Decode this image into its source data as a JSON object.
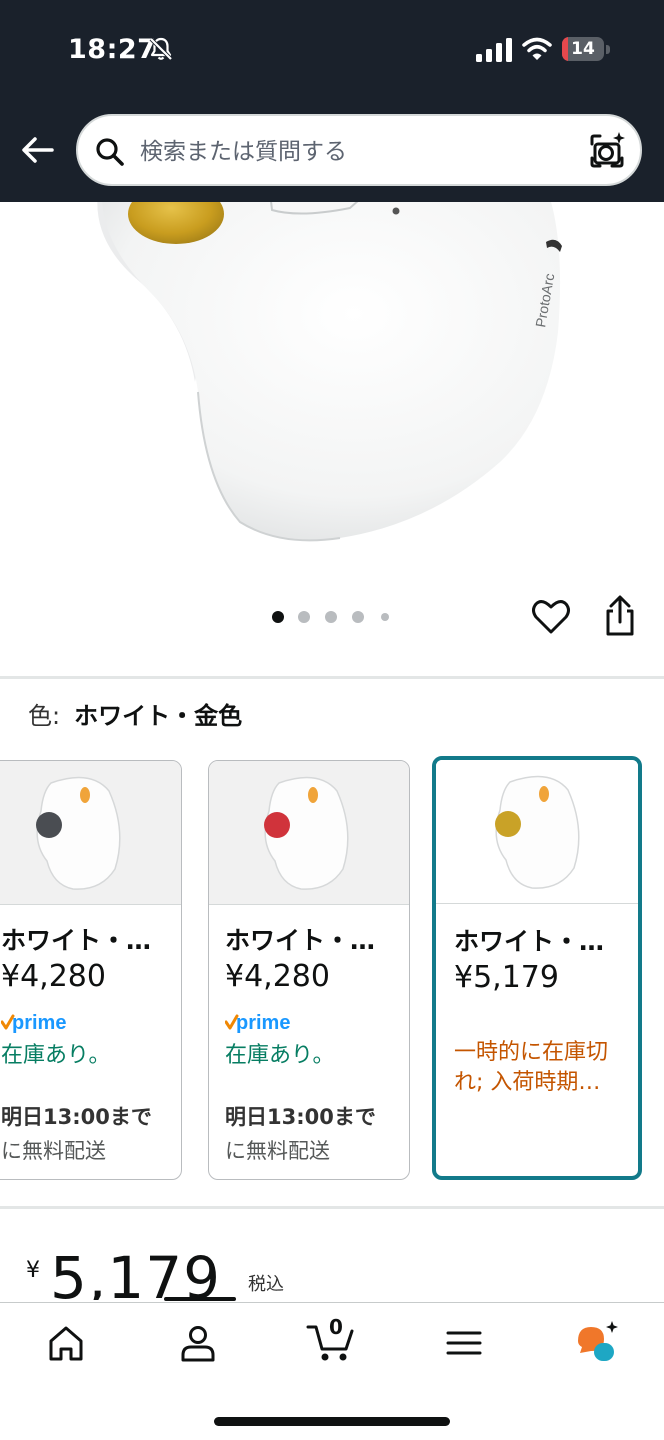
{
  "status_bar": {
    "time": "18:27",
    "battery": "14",
    "battery_level": 0.14
  },
  "search": {
    "placeholder": "検索または質問する"
  },
  "gallery": {
    "image_count": 5,
    "active_index": 0
  },
  "variation": {
    "label": "色:",
    "selected": "ホワイト・金色"
  },
  "swatches": [
    {
      "name": "ホワイト・…",
      "price": "¥4,280",
      "stock": "在庫あり。",
      "delivery_line1": "明日13:00まで",
      "delivery_line2": "に無料配送",
      "ball_color": "#4a4d52"
    },
    {
      "name": "ホワイト・…",
      "price": "¥4,280",
      "stock": "在庫あり。",
      "delivery_line1": "明日13:00まで",
      "delivery_line2": "に無料配送",
      "ball_color": "#d0333b"
    },
    {
      "name": "ホワイト・…",
      "price": "¥5,179",
      "stock": "一時的に在庫切れ; 入荷時期…",
      "ball_color": "#c9a227"
    }
  ],
  "price": {
    "symbol": "¥",
    "amount": "5,179",
    "tax_note": "税込"
  },
  "product_image": {
    "brand_text": "ProtoArc"
  },
  "colors": {
    "header_bg": "#1a212b",
    "selected_border": "#127a8a",
    "in_stock": "#067d62",
    "out_of_stock": "#c45500",
    "prime_blue": "#1a98ff",
    "prime_check": "#f08804"
  },
  "bottom_nav": {
    "cart_count": "0",
    "items": [
      "home-icon",
      "account-icon",
      "cart-icon",
      "menu-icon",
      "rufus-ai-icon"
    ]
  }
}
